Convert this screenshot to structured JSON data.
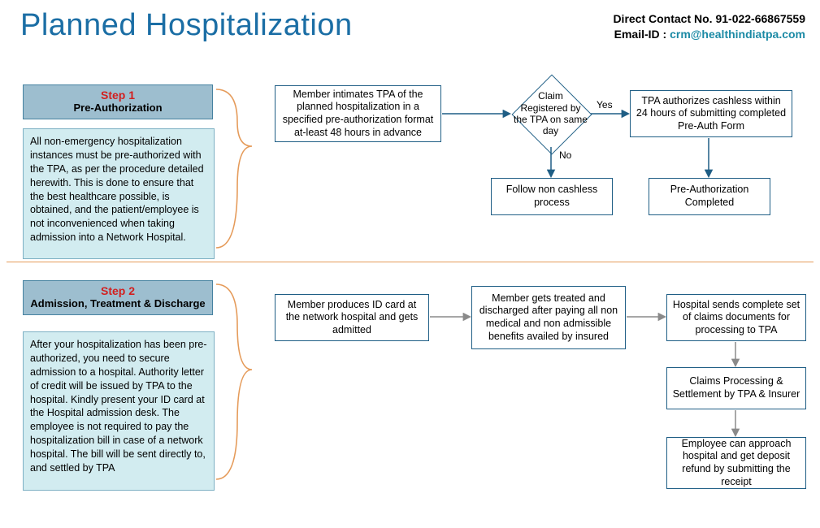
{
  "header": {
    "title": "Planned Hospitalization",
    "contact_label": "Direct Contact No.",
    "contact_value": "91-022-66867559",
    "email_label": "Email-ID  :",
    "email_value": "crm@healthindiatpa.com"
  },
  "step1": {
    "label": "Step 1",
    "subtitle": "Pre-Authorization",
    "description": "All non-emergency  hospitalization instances must be pre-authorized with the TPA, as per the procedure detailed herewith. This is done to ensure that the best healthcare possible, is obtained, and the patient/employee is not inconvenienced  when taking admission into a Network Hospital.",
    "box_intimate": "Member intimates TPA of the planned hospitalization in a specified pre-authorization format at-least 48 hours in advance",
    "decision": "Claim Registered by the TPA on same day",
    "yes": "Yes",
    "no": "No",
    "box_authorize": "TPA authorizes cashless within 24 hours of submitting completed Pre-Auth Form",
    "box_noncashless": "Follow non cashless process",
    "box_completed": "Pre-Authorization Completed"
  },
  "step2": {
    "label": "Step 2",
    "subtitle": "Admission,  Treatment & Discharge",
    "description": "After your hospitalization has been pre-authorized,  you need to secure admission to a hospital. Authority letter of credit will be issued by TPA to the hospital. Kindly present your ID card at the Hospital admission desk. The employee is not required to pay the hospitalization bill in case of a network hospital. The bill will be sent directly to, and settled by TPA",
    "box_idcard": "Member produces ID card at the network hospital and gets admitted",
    "box_treated": "Member gets treated and discharged after paying all non medical and non admissible  benefits availed  by insured",
    "box_hospitalsends": "Hospital sends complete set of claims documents for processing to TPA",
    "box_claims": "Claims Processing & Settlement by TPA & Insurer",
    "box_refund": "Employee can approach hospital and get deposit refund  by submitting  the receipt"
  }
}
